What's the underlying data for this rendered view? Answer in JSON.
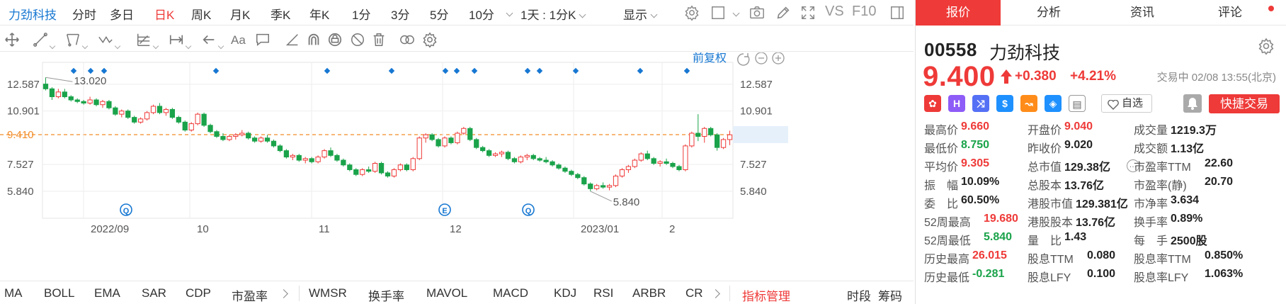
{
  "header": {
    "stock_name": "力劲科技",
    "periods": [
      "分时",
      "多日",
      "日K",
      "周K",
      "月K",
      "季K",
      "年K",
      "1分",
      "3分",
      "5分",
      "10分"
    ],
    "active_period": "日K",
    "kline_select": "1天 : 1分K",
    "display_label": "显示",
    "vs_label": "VS",
    "f10_label": "F10"
  },
  "tools": {
    "text_tool": "Aa"
  },
  "chart": {
    "fq_label": "前复权",
    "price_ticks": [
      "12.587",
      "10.901",
      "9.410",
      "7.527",
      "5.840"
    ],
    "current_price_label": "9.410",
    "high_label": "13.020",
    "low_label": "5.840",
    "x_labels": [
      "2022/09",
      "10",
      "11",
      "12",
      "2023/01",
      "2"
    ],
    "event_markers": [
      "Q",
      "E",
      "Q"
    ],
    "colors": {
      "up": "#ee3a38",
      "down": "#1aa34a",
      "ref": "#f28c28",
      "event": "#1677d2"
    }
  },
  "chart_data": {
    "type": "candlestick",
    "title": "",
    "ylim": [
      5.3,
      13.7
    ],
    "y_ticks": [
      12.587,
      10.901,
      9.41,
      7.527,
      5.84
    ],
    "reference_price": 9.41,
    "period_high": 13.02,
    "period_low": 5.84,
    "x_ticks": [
      "2022/09",
      "10",
      "11",
      "12",
      "2023/01",
      "2"
    ],
    "ohlc": [
      [
        12.6,
        13.02,
        12.2,
        12.3
      ],
      [
        12.3,
        12.4,
        11.6,
        11.8
      ],
      [
        11.8,
        12.3,
        11.7,
        12.1
      ],
      [
        12.1,
        12.3,
        11.7,
        11.8
      ],
      [
        11.8,
        11.9,
        11.5,
        11.6
      ],
      [
        11.6,
        11.7,
        11.4,
        11.5
      ],
      [
        11.5,
        11.6,
        11.3,
        11.4
      ],
      [
        11.4,
        11.8,
        11.3,
        11.6
      ],
      [
        11.6,
        11.7,
        11.2,
        11.3
      ],
      [
        11.3,
        11.6,
        11.1,
        11.5
      ],
      [
        11.5,
        11.6,
        11.0,
        11.1
      ],
      [
        11.1,
        11.2,
        10.6,
        10.7
      ],
      [
        10.7,
        11.0,
        10.5,
        10.9
      ],
      [
        10.9,
        11.0,
        10.4,
        10.5
      ],
      [
        10.5,
        10.6,
        10.1,
        10.2
      ],
      [
        10.2,
        10.5,
        10.1,
        10.4
      ],
      [
        10.4,
        10.9,
        10.3,
        10.8
      ],
      [
        10.8,
        11.3,
        10.7,
        11.2
      ],
      [
        11.2,
        11.4,
        10.7,
        10.8
      ],
      [
        10.8,
        11.1,
        10.6,
        11.0
      ],
      [
        11.0,
        11.1,
        10.4,
        10.5
      ],
      [
        10.5,
        10.6,
        10.1,
        10.2
      ],
      [
        10.2,
        10.3,
        9.6,
        9.7
      ],
      [
        9.7,
        10.2,
        9.6,
        10.1
      ],
      [
        10.1,
        10.8,
        10.0,
        10.7
      ],
      [
        10.7,
        10.8,
        9.9,
        10.0
      ],
      [
        10.0,
        10.1,
        9.5,
        9.6
      ],
      [
        9.6,
        9.7,
        9.2,
        9.3
      ],
      [
        9.3,
        9.5,
        9.0,
        9.1
      ],
      [
        9.1,
        9.4,
        9.0,
        9.3
      ],
      [
        9.3,
        9.5,
        9.1,
        9.4
      ],
      [
        9.4,
        9.7,
        9.3,
        9.5
      ],
      [
        9.5,
        9.6,
        9.1,
        9.2
      ],
      [
        9.2,
        9.3,
        8.9,
        9.0
      ],
      [
        9.0,
        9.3,
        8.9,
        9.2
      ],
      [
        9.2,
        9.4,
        8.9,
        9.0
      ],
      [
        9.0,
        9.1,
        8.6,
        8.7
      ],
      [
        8.7,
        8.8,
        8.3,
        8.4
      ],
      [
        8.4,
        8.5,
        7.9,
        8.0
      ],
      [
        8.0,
        8.2,
        7.8,
        8.1
      ],
      [
        8.1,
        8.2,
        7.7,
        7.8
      ],
      [
        7.8,
        8.0,
        7.6,
        7.9
      ],
      [
        7.9,
        8.0,
        7.6,
        7.7
      ],
      [
        7.7,
        8.1,
        7.6,
        8.0
      ],
      [
        8.0,
        8.5,
        7.9,
        8.4
      ],
      [
        8.4,
        8.6,
        8.0,
        8.1
      ],
      [
        8.1,
        8.2,
        7.7,
        7.8
      ],
      [
        7.8,
        7.9,
        7.4,
        7.5
      ],
      [
        7.5,
        7.6,
        7.1,
        7.2
      ],
      [
        7.2,
        7.3,
        6.8,
        6.9
      ],
      [
        6.9,
        7.3,
        6.8,
        7.2
      ],
      [
        7.2,
        7.4,
        7.0,
        7.1
      ],
      [
        7.1,
        7.7,
        7.0,
        7.6
      ],
      [
        7.6,
        7.7,
        6.9,
        7.0
      ],
      [
        7.0,
        7.1,
        6.7,
        6.8
      ],
      [
        6.8,
        7.3,
        6.7,
        7.2
      ],
      [
        7.2,
        7.6,
        7.1,
        7.5
      ],
      [
        7.5,
        7.6,
        7.1,
        7.2
      ],
      [
        7.2,
        8.0,
        7.1,
        7.9
      ],
      [
        7.9,
        9.3,
        7.8,
        9.2
      ],
      [
        9.2,
        9.5,
        8.9,
        9.4
      ],
      [
        9.4,
        9.5,
        9.0,
        9.1
      ],
      [
        9.1,
        9.2,
        8.6,
        8.7
      ],
      [
        8.7,
        9.3,
        8.6,
        9.2
      ],
      [
        9.2,
        9.3,
        8.8,
        8.9
      ],
      [
        8.9,
        9.6,
        8.8,
        9.5
      ],
      [
        9.5,
        9.9,
        9.4,
        9.8
      ],
      [
        9.8,
        9.9,
        9.0,
        9.1
      ],
      [
        9.1,
        9.2,
        8.5,
        8.6
      ],
      [
        8.6,
        8.7,
        8.3,
        8.4
      ],
      [
        8.4,
        8.5,
        8.0,
        8.1
      ],
      [
        8.1,
        8.3,
        8.0,
        8.2
      ],
      [
        8.2,
        8.4,
        8.0,
        8.3
      ],
      [
        8.3,
        8.4,
        7.8,
        7.9
      ],
      [
        7.9,
        8.0,
        7.6,
        7.7
      ],
      [
        7.7,
        8.1,
        7.6,
        8.0
      ],
      [
        8.0,
        8.2,
        7.8,
        8.1
      ],
      [
        8.1,
        8.2,
        7.8,
        7.9
      ],
      [
        7.9,
        8.0,
        7.7,
        7.8
      ],
      [
        7.8,
        8.0,
        7.6,
        7.7
      ],
      [
        7.7,
        7.8,
        7.4,
        7.5
      ],
      [
        7.5,
        7.6,
        7.2,
        7.3
      ],
      [
        7.3,
        7.4,
        7.0,
        7.1
      ],
      [
        7.1,
        7.2,
        6.8,
        6.9
      ],
      [
        6.9,
        7.0,
        6.6,
        6.7
      ],
      [
        6.7,
        6.8,
        6.2,
        6.3
      ],
      [
        6.3,
        6.4,
        5.84,
        6.0
      ],
      [
        6.0,
        6.3,
        5.9,
        6.2
      ],
      [
        6.2,
        6.4,
        6.0,
        6.1
      ],
      [
        6.1,
        6.3,
        5.9,
        6.2
      ],
      [
        6.2,
        6.9,
        6.1,
        6.8
      ],
      [
        6.8,
        7.3,
        6.7,
        7.2
      ],
      [
        7.2,
        7.5,
        7.0,
        7.4
      ],
      [
        7.4,
        7.9,
        7.3,
        7.8
      ],
      [
        7.8,
        8.3,
        7.7,
        8.2
      ],
      [
        8.2,
        8.4,
        7.8,
        7.9
      ],
      [
        7.9,
        8.0,
        7.5,
        7.6
      ],
      [
        7.6,
        7.8,
        7.4,
        7.7
      ],
      [
        7.7,
        7.9,
        7.5,
        7.6
      ],
      [
        7.6,
        7.7,
        7.3,
        7.4
      ],
      [
        7.4,
        7.5,
        7.1,
        7.2
      ],
      [
        7.2,
        8.8,
        7.1,
        8.7
      ],
      [
        8.7,
        9.6,
        8.6,
        9.5
      ],
      [
        9.5,
        10.7,
        9.0,
        9.3
      ],
      [
        9.3,
        9.9,
        8.9,
        9.8
      ],
      [
        9.8,
        9.9,
        9.3,
        9.4
      ],
      [
        9.4,
        9.5,
        8.4,
        8.6
      ],
      [
        8.6,
        9.2,
        8.5,
        9.1
      ],
      [
        9.1,
        9.66,
        8.75,
        9.4
      ]
    ]
  },
  "indicators": {
    "items": [
      "MA",
      "BOLL",
      "EMA",
      "SAR",
      "CDP",
      "市盈率",
      "WMSR",
      "换手率",
      "MAVOL",
      "MACD",
      "KDJ",
      "RSI",
      "ARBR",
      "CR"
    ],
    "manage_label": "指标管理",
    "right_items": [
      "时段",
      "筹码"
    ]
  },
  "tabs": [
    "报价",
    "分析",
    "资讯",
    "评论"
  ],
  "active_tab": "报价",
  "quote": {
    "code": "00558",
    "name": "力劲科技",
    "price": "9.400",
    "change": "+0.380",
    "change_pct": "+4.21%",
    "status": "交易中 02/08 13:55(北京)",
    "watch_label": "自选",
    "quick_trade": "快捷交易",
    "badges": [
      "HK",
      "H",
      "S",
      "$",
      "~",
      "tag",
      "doc"
    ]
  },
  "stats": [
    [
      {
        "label": "最高价",
        "value": "9.660",
        "color": "red"
      },
      {
        "label": "开盘价",
        "value": "9.040",
        "color": "red"
      },
      {
        "label": "成交量",
        "value": "1219.3万",
        "color": ""
      }
    ],
    [
      {
        "label": "最低价",
        "value": "8.750",
        "color": "green"
      },
      {
        "label": "昨收价",
        "value": "9.020",
        "color": ""
      },
      {
        "label": "成交额",
        "value": "1.13亿",
        "color": ""
      }
    ],
    [
      {
        "label": "平均价",
        "value": "9.305",
        "color": "red"
      },
      {
        "label": "总市值",
        "value": "129.38亿",
        "color": ""
      },
      {
        "label": "市盈率TTM",
        "value": "22.60",
        "color": ""
      }
    ],
    [
      {
        "label": "振　幅",
        "value": "10.09%",
        "color": ""
      },
      {
        "label": "总股本",
        "value": "13.76亿",
        "color": ""
      },
      {
        "label": "市盈率(静)",
        "value": "20.70",
        "color": ""
      }
    ],
    [
      {
        "label": "委　比",
        "value": "60.50%",
        "color": ""
      },
      {
        "label": "港股市值",
        "value": "129.381亿",
        "color": ""
      },
      {
        "label": "市净率",
        "value": "3.634",
        "color": ""
      }
    ],
    [
      {
        "label": "52周最高",
        "value": "19.680",
        "color": "red"
      },
      {
        "label": "港股股本",
        "value": "13.76亿",
        "color": ""
      },
      {
        "label": "换手率",
        "value": "0.89%",
        "color": ""
      }
    ],
    [
      {
        "label": "52周最低",
        "value": "5.840",
        "color": "green"
      },
      {
        "label": "量　比",
        "value": "1.43",
        "color": ""
      },
      {
        "label": "每　手",
        "value": "2500股",
        "color": ""
      }
    ],
    [
      {
        "label": "历史最高",
        "value": "26.015",
        "color": "red"
      },
      {
        "label": "股息TTM",
        "value": "0.080",
        "color": ""
      },
      {
        "label": "股息率TTM",
        "value": "0.850%",
        "color": ""
      }
    ],
    [
      {
        "label": "历史最低",
        "value": "-0.281",
        "color": "green"
      },
      {
        "label": "股息LFY",
        "value": "0.100",
        "color": ""
      },
      {
        "label": "股息率LFY",
        "value": "1.063%",
        "color": ""
      }
    ]
  ]
}
